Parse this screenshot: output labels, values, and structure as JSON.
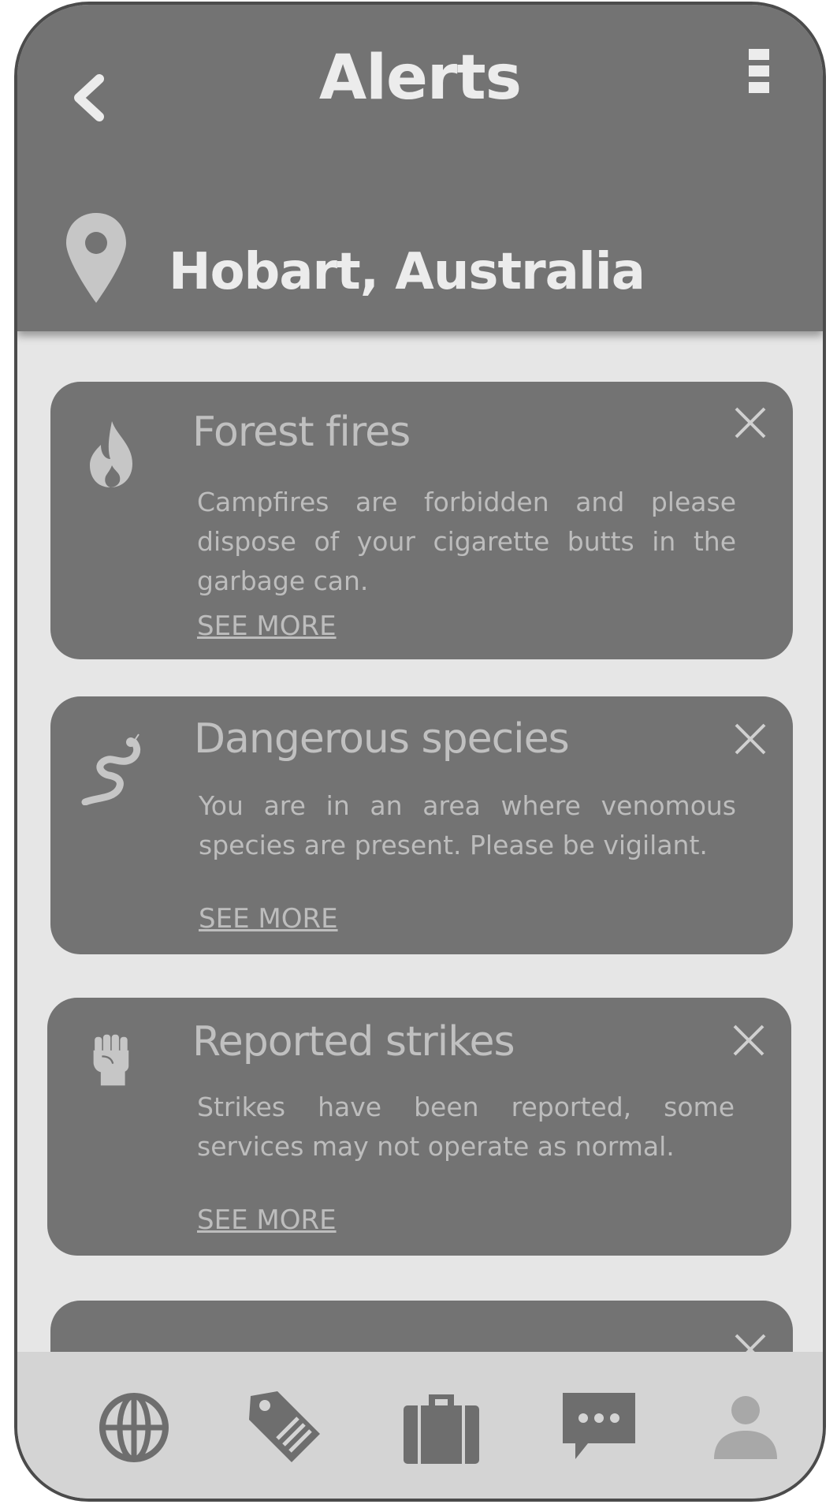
{
  "header": {
    "title": "Alerts",
    "location": "Hobart, Australia",
    "back_icon": "chevron-left-icon",
    "menu_icon": "kebab-menu-icon",
    "location_icon": "map-pin-icon"
  },
  "alerts": [
    {
      "icon": "fire-icon",
      "title": "Forest fires",
      "body": "Campfires are forbidden and please dispose of your cigarette butts in the garbage can.",
      "link": "SEE MORE"
    },
    {
      "icon": "snake-icon",
      "title": "Dangerous species",
      "body": "You are in an area where venomous species are present. Please be vigilant.",
      "link": "SEE MORE"
    },
    {
      "icon": "raised-fist-icon",
      "title": "Reported strikes",
      "body": "Strikes have been reported, some services may not operate as normal.",
      "link": "SEE MORE"
    }
  ],
  "nav": [
    "globe-icon",
    "tag-icon",
    "briefcase-icon",
    "chat-icon",
    "user-icon"
  ],
  "colors": {
    "header": "#737373",
    "card": "#737373",
    "background": "#e6e6e6",
    "nav": "#d4d4d4",
    "text_light": "#ececec",
    "text_muted": "#bdbdbd"
  }
}
